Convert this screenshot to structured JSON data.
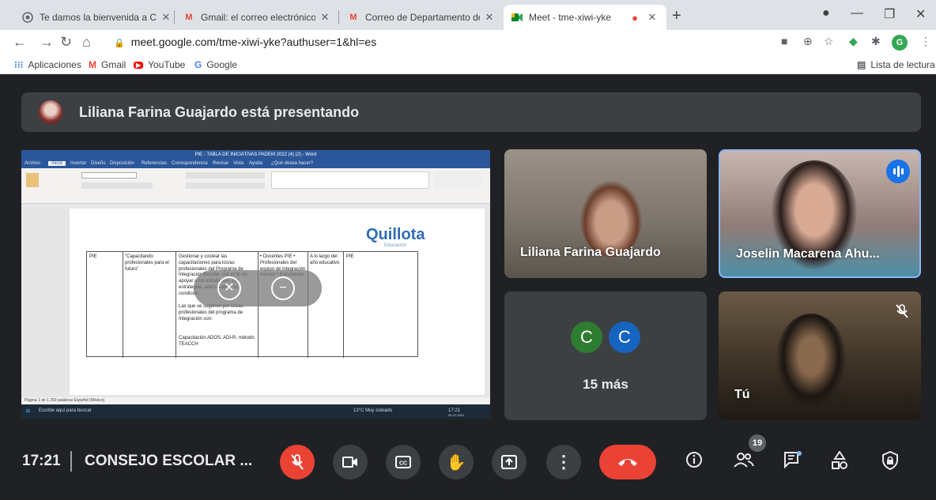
{
  "browser": {
    "tabs": [
      {
        "label": "Te damos la bienvenida a Chrom",
        "icon": "chrome-icon"
      },
      {
        "label": "Gmail: el correo electrónico de G",
        "icon": "gmail-icon"
      },
      {
        "label": "Correo de Departamento de Edu",
        "icon": "gmail-icon"
      },
      {
        "label": "Meet - tme-xiwi-yke",
        "icon": "meet-icon",
        "active": true,
        "recording": true
      }
    ],
    "url": "meet.google.com/tme-xiwi-yke?authuser=1&hl=es",
    "profile_initial": "G",
    "bookmarks": [
      "Aplicaciones",
      "Gmail",
      "YouTube",
      "Google"
    ],
    "reading_list": "Lista de lectura"
  },
  "meet": {
    "presenter_banner": "Liliana Farina Guajardo está presentando",
    "shared_screen": {
      "word_title": "PIE - TABLA DE INICIATIVAS PADEM 2022 (4) (2)  -  Word",
      "menu": [
        "Archivo",
        "Inicio",
        "Insertar",
        "Diseño",
        "Disposición",
        "Referencias",
        "Correspondencia",
        "Revisar",
        "Vista",
        "Ayuda",
        "¿Qué desea hacer?"
      ],
      "logo": "Quillota",
      "logo_sub": "Educación",
      "table": {
        "col1": "PIE",
        "col2": "\"Capacitando profesionales para el futuro\"",
        "col3": "Gestionar y costear las capacitaciones para los/as profesionales del Programa de Integración Escolar, con el fin de apoyar a los estudiantes con estrategias, adecuadas a su condición.",
        "col3b": "Las que se sugieren por los/as profesionales del programa de Integración son:",
        "col3c": "Capacitación ADOS, ADI-R, método TEACCH",
        "col4": "• Docentes PIE  • Profesionales del equipo de integración escolar  • Estudiantes",
        "col5": "A lo largo del año educativo",
        "col6": "PIE"
      },
      "status": "Página 1 de 1    250 palabras    Español (México)",
      "taskbar_search": "Escribe aquí para buscar",
      "taskbar_weather": "13°C  Muy soleado",
      "taskbar_time": "17:21",
      "taskbar_date": "05-07-2021"
    },
    "participants": [
      {
        "name": "Liliana Farina Guajardo"
      },
      {
        "name": "Joselin Macarena Ahu...",
        "speaking": true
      }
    ],
    "others": {
      "avatar1": "C",
      "avatar2": "C",
      "avatar1_color": "#2e7d32",
      "avatar2_color": "#1565c0",
      "more_label": "15 más"
    },
    "self_tile": {
      "name": "Tú",
      "muted": true
    },
    "time": "17:21",
    "meeting_title": "CONSEJO ESCOLAR ...",
    "participant_count": "19",
    "accent_red": "#ea4335",
    "accent_blue": "#1a73e8"
  }
}
